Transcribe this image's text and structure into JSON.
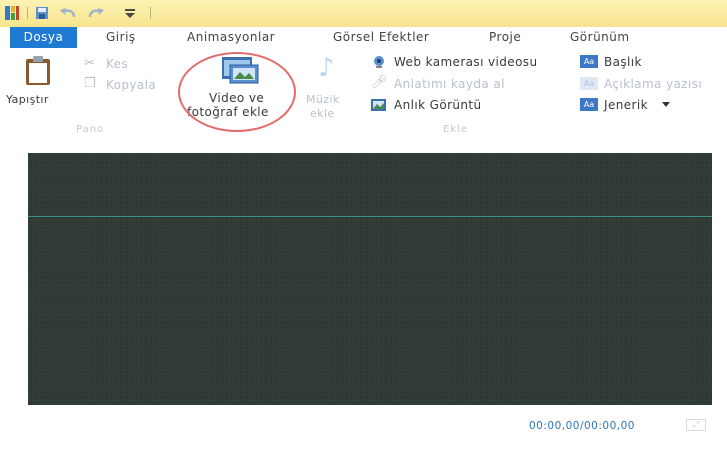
{
  "quick_access": {
    "icons": [
      "app-icon",
      "save-icon",
      "undo-icon",
      "redo-icon",
      "customize-dropdown-icon"
    ]
  },
  "tabs": [
    {
      "label": "Dosya"
    },
    {
      "label": "Giriş"
    },
    {
      "label": "Animasyonlar"
    },
    {
      "label": "Görsel Efektler"
    },
    {
      "label": "Proje"
    },
    {
      "label": "Görünüm"
    }
  ],
  "ribbon": {
    "clipboard": {
      "paste_label": "Yapıştır",
      "cut_label": "Kes",
      "copy_label": "Kopyala",
      "group_label": "Pano"
    },
    "add": {
      "add_video_photo_line1": "Video ve",
      "add_video_photo_line2": "fotoğraf ekle",
      "add_music_line1": "Müzik",
      "add_music_line2": "ekle",
      "webcam_label": "Web kamerası videosu",
      "narration_label": "Anlatımı kayda al",
      "snapshot_label": "Anlık Görüntü",
      "title_label": "Başlık",
      "caption_label": "Açıklama yazısı",
      "credits_label": "Jenerik",
      "group_label": "Ekle"
    }
  },
  "preview": {
    "time_display": "00:00,00/00:00,00"
  },
  "colors": {
    "titlebar": "#f6e48e",
    "file_tab": "#1f7ad4",
    "highlight_circle": "#e36b6b",
    "preview_bg": "#2e3a35",
    "time_text": "#2f74b9"
  }
}
